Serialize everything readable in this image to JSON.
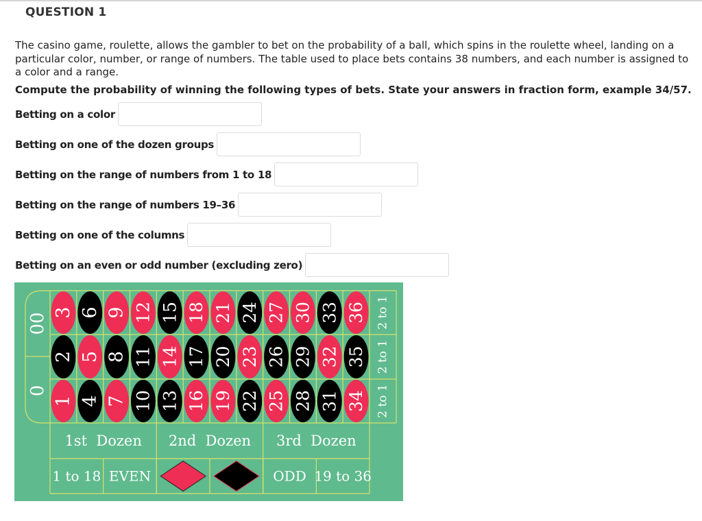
{
  "question": {
    "title": "QUESTION 1",
    "intro": "The casino game, roulette, allows the gambler to bet on the probability of a ball, which spins in the roulette wheel, landing on a particular color, number, or range of numbers. The table used to place bets contains 38 numbers, and each number is assigned to a color and a range.",
    "instruction": "Compute the probability of winning the following types of bets. State your answers in fraction form, example 34/57."
  },
  "items": [
    {
      "label": "Betting on a color",
      "value": "",
      "placeholder": ""
    },
    {
      "label": "Betting on one of the dozen groups",
      "value": "",
      "placeholder": ""
    },
    {
      "label": "Betting on the range of numbers from 1 to 18",
      "value": "",
      "placeholder": ""
    },
    {
      "label": "Betting on the range of numbers 19–36",
      "value": "",
      "placeholder": ""
    },
    {
      "label": "Betting on one of the columns",
      "value": "",
      "placeholder": ""
    },
    {
      "label": "Betting on an even or odd number (excluding zero)",
      "value": "",
      "placeholder": ""
    }
  ],
  "roulette_table": {
    "colors": {
      "felt": "#5fba8e",
      "lines": "#d7e26a",
      "red": "#ee2e55",
      "black": "#000000",
      "text": "#ffffff"
    },
    "zeros": [
      "0",
      "00"
    ],
    "columns_payout": [
      "2 to 1",
      "2 to 1",
      "2 to 1"
    ],
    "grid_columns": [
      {
        "top": {
          "n": "3",
          "color": "red"
        },
        "mid": {
          "n": "2",
          "color": "black"
        },
        "bottom": {
          "n": "1",
          "color": "red"
        }
      },
      {
        "top": {
          "n": "6",
          "color": "black"
        },
        "mid": {
          "n": "5",
          "color": "red"
        },
        "bottom": {
          "n": "4",
          "color": "black"
        }
      },
      {
        "top": {
          "n": "9",
          "color": "red"
        },
        "mid": {
          "n": "8",
          "color": "black"
        },
        "bottom": {
          "n": "7",
          "color": "red"
        }
      },
      {
        "top": {
          "n": "12",
          "color": "red"
        },
        "mid": {
          "n": "11",
          "color": "black"
        },
        "bottom": {
          "n": "10",
          "color": "black"
        }
      },
      {
        "top": {
          "n": "15",
          "color": "black"
        },
        "mid": {
          "n": "14",
          "color": "red"
        },
        "bottom": {
          "n": "13",
          "color": "black"
        }
      },
      {
        "top": {
          "n": "18",
          "color": "red"
        },
        "mid": {
          "n": "17",
          "color": "black"
        },
        "bottom": {
          "n": "16",
          "color": "red"
        }
      },
      {
        "top": {
          "n": "21",
          "color": "red"
        },
        "mid": {
          "n": "20",
          "color": "black"
        },
        "bottom": {
          "n": "19",
          "color": "red"
        }
      },
      {
        "top": {
          "n": "24",
          "color": "black"
        },
        "mid": {
          "n": "23",
          "color": "red"
        },
        "bottom": {
          "n": "22",
          "color": "black"
        }
      },
      {
        "top": {
          "n": "27",
          "color": "red"
        },
        "mid": {
          "n": "26",
          "color": "black"
        },
        "bottom": {
          "n": "25",
          "color": "red"
        }
      },
      {
        "top": {
          "n": "30",
          "color": "red"
        },
        "mid": {
          "n": "29",
          "color": "black"
        },
        "bottom": {
          "n": "28",
          "color": "black"
        }
      },
      {
        "top": {
          "n": "33",
          "color": "black"
        },
        "mid": {
          "n": "32",
          "color": "red"
        },
        "bottom": {
          "n": "31",
          "color": "black"
        }
      },
      {
        "top": {
          "n": "36",
          "color": "red"
        },
        "mid": {
          "n": "35",
          "color": "black"
        },
        "bottom": {
          "n": "34",
          "color": "red"
        }
      }
    ],
    "dozens": [
      "1st  Dozen",
      "2nd  Dozen",
      "3rd  Dozen"
    ],
    "outside_bets": [
      {
        "label": "1 to 18",
        "type": "text"
      },
      {
        "label": "EVEN",
        "type": "text"
      },
      {
        "label": "red-diamond",
        "type": "diamond",
        "color": "red"
      },
      {
        "label": "black-diamond",
        "type": "diamond",
        "color": "black"
      },
      {
        "label": "ODD",
        "type": "text"
      },
      {
        "label": "19 to 36",
        "type": "text"
      }
    ]
  }
}
